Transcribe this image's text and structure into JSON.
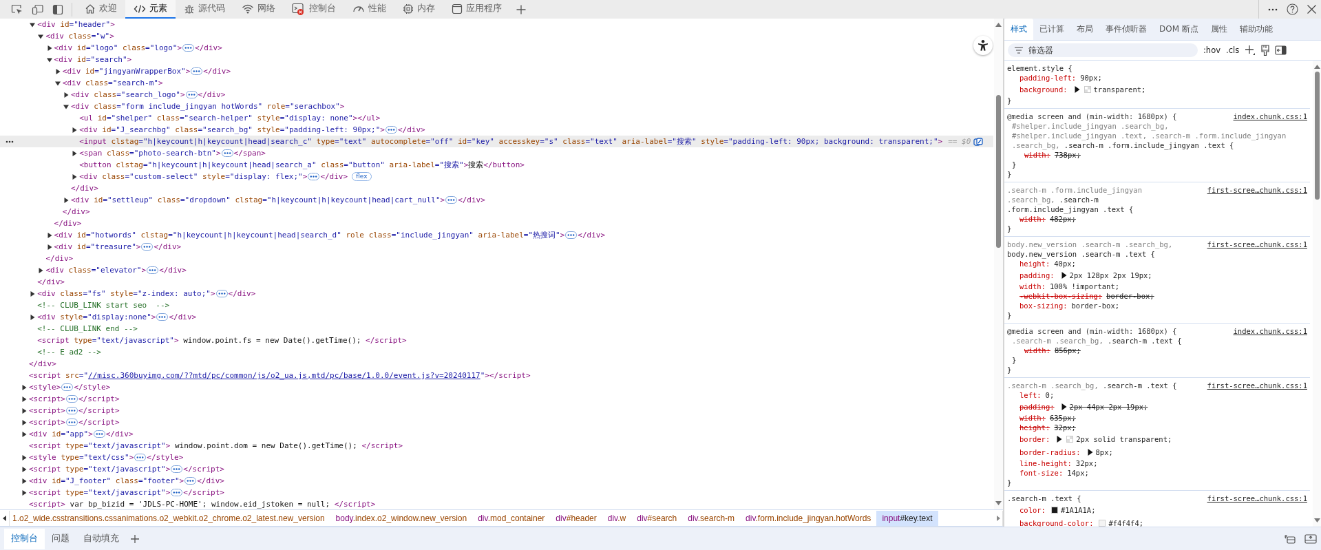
{
  "toolbar": {
    "tabs": [
      {
        "label": "欢迎",
        "selected": false,
        "errors": false
      },
      {
        "label": "元素",
        "selected": true,
        "errors": false
      },
      {
        "label": "源代码",
        "selected": false,
        "errors": false
      },
      {
        "label": "网络",
        "selected": false,
        "errors": false
      },
      {
        "label": "控制台",
        "selected": false,
        "errors": true
      },
      {
        "label": "性能",
        "selected": false,
        "errors": false
      },
      {
        "label": "内存",
        "selected": false,
        "errors": false
      },
      {
        "label": "应用程序",
        "selected": false,
        "errors": false
      }
    ]
  },
  "dom": [
    {
      "children": [
        {
          "open": [
            "<div id=\"header\">"
          ],
          "expanded": true,
          "selected": false,
          "children": [
            {
              "open": [
                "<div class=\"w\">"
              ],
              "expanded": true,
              "selected": false,
              "children": [
                {
                  "open": [
                    "<div id=\"logo\" class=\"logo\">"
                  ],
                  "expanded": false,
                  "selected": false,
                  "close": [
                    "</div>"
                  ]
                },
                {
                  "open": [
                    "<div id=\"search\">"
                  ],
                  "expanded": true,
                  "selected": false,
                  "children": [
                    {
                      "open": [
                        "<div id=\"jingyanWrapperBox\">"
                      ],
                      "expanded": false,
                      "selected": false,
                      "close": [
                        "</div>"
                      ]
                    },
                    {
                      "open": [
                        "<div class=\"search-m\">"
                      ],
                      "expanded": true,
                      "selected": false,
                      "children": [
                        {
                          "open": [
                            "<div class=\"search_logo\">"
                          ],
                          "expanded": false,
                          "selected": false,
                          "close": [
                            "</div>"
                          ]
                        },
                        {
                          "open": [
                            "<div class=\"form include_jingyan hotWords\" role=\"serachbox\">"
                          ],
                          "expanded": true,
                          "selected": false,
                          "children": [
                            {
                              "open": [
                                "<ul id=\"shelper\" class=\"search-helper\" style=\"display: none\">"
                              ],
                              "selected": false,
                              "close": [
                                "</ul>"
                              ]
                            },
                            {
                              "open": [
                                "<div id=\"J_searchbg\" class=\"search_bg\" style=\"padding-left: 90px;\">"
                              ],
                              "expanded": false,
                              "selected": false,
                              "close": [
                                "</div>"
                              ]
                            },
                            {
                              "open": [
                                "<input clstag=\"h|keycount|h|keycount|head|search_c\" type=\"text\" autocomplete=\"off\" id=\"key\" accesskey=\"s\" class=\"text\" aria-label=\"搜索\" style=\"padding-left: 90px; background: transparent;\">"
                              ],
                              "selected": true,
                              "marker": "== $0"
                            },
                            {
                              "open": [
                                "<span class=\"photo-search-btn\">"
                              ],
                              "expanded": false,
                              "selected": false,
                              "close": [
                                "</span>"
                              ]
                            },
                            {
                              "open": [
                                "<button clstag=\"h|keycount|h|keycount|head|search_a\" class=\"button\" aria-label=\"搜索\">",
                                {
                                  "kind": "text",
                                  "text": "搜索"
                                }
                              ],
                              "selected": false,
                              "close": [
                                "</button>"
                              ]
                            },
                            {
                              "open": [
                                "<div class=\"custom-select\" style=\"display: flex;\">"
                              ],
                              "expanded": false,
                              "selected": false,
                              "close": [
                                "</div>"
                              ],
                              "badge": "flex"
                            }
                          ],
                          "close": [
                            "</div>"
                          ]
                        },
                        {
                          "open": [
                            "<div id=\"settleup\" class=\"dropdown\" clstag=\"h|keycount|h|keycount|head|cart_null\">"
                          ],
                          "expanded": false,
                          "selected": false,
                          "close": [
                            "</div>"
                          ]
                        }
                      ],
                      "close": [
                        "</div>"
                      ]
                    }
                  ],
                  "close": [
                    "</div>"
                  ]
                },
                {
                  "open": [
                    "<div id=\"hotwords\" clstag=\"h|keycount|h|keycount|head|search_d\" role class=\"include_jingyan\" aria-label=\"热搜词\">"
                  ],
                  "expanded": false,
                  "selected": false,
                  "close": [
                    "</div>"
                  ]
                },
                {
                  "open": [
                    "<div id=\"treasure\">"
                  ],
                  "expanded": false,
                  "selected": false,
                  "close": [
                    "</div>"
                  ]
                }
              ],
              "close": [
                "</div>"
              ]
            },
            {
              "open": [
                "<div class=\"elevator\">"
              ],
              "expanded": false,
              "selected": false,
              "close": [
                "</div>"
              ]
            }
          ],
          "close": [
            "</div>"
          ]
        },
        {
          "open": [
            "<div class=\"fs\" style=\"z-index: auto;\">"
          ],
          "expanded": false,
          "selected": false,
          "close": [
            "</div>"
          ]
        },
        {
          "open": [
            {
              "kind": "comment",
              "text": "<!-- CLUB_LINK start seo  -->"
            }
          ],
          "selected": false
        },
        {
          "open": [
            "<div style=\"display:none\">"
          ],
          "expanded": false,
          "selected": false,
          "close": [
            "</div>"
          ]
        },
        {
          "open": [
            {
              "kind": "comment",
              "text": "<!-- CLUB_LINK end -->"
            }
          ],
          "selected": false
        },
        {
          "open": [
            "<script type=\"text/javascript\">",
            {
              "kind": "text",
              "text": " window.point.fs = new Date().getTime(); "
            }
          ],
          "selected": false,
          "close": [
            "</script>"
          ]
        },
        {
          "open": [
            {
              "kind": "comment",
              "text": "<!-- E ad2 -->"
            }
          ],
          "selected": false
        }
      ],
      "close": [
        "</div>"
      ]
    },
    {
      "open": [
        "<script src=\"",
        {
          "kind": "link",
          "text": "//misc.360buyimg.com/??mtd/pc/common/js/o2_ua.js,mtd/pc/base/1.0.0/event.js?v=20240117"
        },
        "\">"
      ],
      "selected": false,
      "close": [
        "</script>"
      ]
    },
    {
      "open": [
        "<style>"
      ],
      "expanded": false,
      "selected": false,
      "close": [
        "</style>"
      ]
    },
    {
      "open": [
        "<script>"
      ],
      "expanded": false,
      "selected": false,
      "close": [
        "</script>"
      ]
    },
    {
      "open": [
        "<script>"
      ],
      "expanded": false,
      "selected": false,
      "close": [
        "</script>"
      ]
    },
    {
      "open": [
        "<script>"
      ],
      "expanded": false,
      "selected": false,
      "close": [
        "</script>"
      ]
    },
    {
      "open": [
        "<div id=\"app\">"
      ],
      "expanded": false,
      "selected": false,
      "close": [
        "</div>"
      ]
    },
    {
      "open": [
        "<script type=\"text/javascript\">",
        {
          "kind": "text",
          "text": " window.point.dom = new Date().getTime(); "
        }
      ],
      "selected": false,
      "close": [
        "</script>"
      ]
    },
    {
      "open": [
        "<style type=\"text/css\">"
      ],
      "expanded": false,
      "selected": false,
      "close": [
        "</style>"
      ]
    },
    {
      "open": [
        "<script type=\"text/javascript\">"
      ],
      "expanded": false,
      "selected": false,
      "close": [
        "</script>"
      ]
    },
    {
      "open": [
        "<div id=\"J_footer\" class=\"footer\">"
      ],
      "expanded": false,
      "selected": false,
      "close": [
        "</div>"
      ]
    },
    {
      "open": [
        "<script type=\"text/javascript\">"
      ],
      "expanded": false,
      "selected": false,
      "close": [
        "</script>"
      ]
    },
    {
      "open": [
        "<script>",
        {
          "kind": "text",
          "text": " var bp_bizid = 'JDLS-PC-HOME'; window.eid_jstoken = null; "
        }
      ],
      "selected": false,
      "close": [
        "</script>"
      ]
    }
  ],
  "breadcrumbs": [
    {
      "label": "1.o2_wide.csstransitions.cssanimations.o2_webkit.o2_chrome.o2_latest.new_version",
      "selected": false
    },
    {
      "label": "body.index.o2_window.new_version",
      "selected": false
    },
    {
      "label": "div.mod_container",
      "selected": false
    },
    {
      "label": "div#header",
      "selected": false
    },
    {
      "label": "div.w",
      "selected": false
    },
    {
      "label": "div#search",
      "selected": false
    },
    {
      "label": "div.search-m",
      "selected": false
    },
    {
      "label": "div.form.include_jingyan.hotWords",
      "selected": false
    },
    {
      "label": "input#key.text",
      "selected": true
    }
  ],
  "sidebar": {
    "tabs": [
      {
        "label": "样式",
        "selected": true
      },
      {
        "label": "已计算",
        "selected": false
      },
      {
        "label": "布局",
        "selected": false
      },
      {
        "label": "事件侦听器",
        "selected": false
      },
      {
        "label": "DOM 断点",
        "selected": false
      },
      {
        "label": "属性",
        "selected": false
      },
      {
        "label": "辅助功能",
        "selected": false
      }
    ],
    "filter": {
      "placeholder": "筛选器"
    },
    "toggles": [
      ":hov",
      ".cls"
    ],
    "rules": [
      {
        "selector": [
          [
            {
              "text": "element.style {",
              "matched": true
            }
          ]
        ],
        "close": "}",
        "properties": [
          {
            "name": "padding-left:",
            "value": "90px;",
            "overridden": false,
            "expandable": false,
            "swatch": false
          },
          {
            "name": "background:",
            "value": "transparent;",
            "overridden": false,
            "expandable": true,
            "swatch": true
          }
        ]
      },
      {
        "media": "@media screen and (min-width: 1680px) {",
        "media_close": "}",
        "source": "index.chunk.css:1",
        "selector": [
          [
            {
              "text": "#shelper.include_jingyan .search_bg,",
              "matched": false
            }
          ],
          [
            {
              "text": "#shelper.include_jingyan .text, .search-m .form.include_jingyan",
              "matched": false
            }
          ],
          [
            {
              "text": ".search_bg,",
              "matched": false
            },
            {
              "text": " .search-m .form.include_jingyan .text {",
              "matched": true
            }
          ]
        ],
        "close": "}",
        "properties": [
          {
            "name": "width:",
            "value": "738px;",
            "overridden": true,
            "expandable": false,
            "swatch": false
          }
        ]
      },
      {
        "source": "first-scree…chunk.css:1",
        "selector": [
          [
            {
              "text": ".search-m .form.include_jingyan",
              "matched": false
            }
          ],
          [
            {
              "text": ".search_bg,",
              "matched": false
            },
            {
              "text": " .search-m",
              "matched": true
            }
          ],
          [
            {
              "text": ".form.include_jingyan .text {",
              "matched": true
            }
          ]
        ],
        "close": "}",
        "properties": [
          {
            "name": "width:",
            "value": "482px;",
            "overridden": true,
            "expandable": false,
            "swatch": false
          }
        ]
      },
      {
        "source": "first-scree…chunk.css:1",
        "selector": [
          [
            {
              "text": "body.new_version .search-m .search_bg,",
              "matched": false
            }
          ],
          [
            {
              "text": "body.new_version .search-m .text {",
              "matched": true
            }
          ]
        ],
        "close": "}",
        "properties": [
          {
            "name": "height:",
            "value": "40px;",
            "overridden": false,
            "expandable": false,
            "swatch": false
          },
          {
            "name": "padding:",
            "value": "2px 128px 2px 19px;",
            "overridden": false,
            "expandable": true,
            "swatch": false
          },
          {
            "name": "width:",
            "value": "100% !important;",
            "overridden": false,
            "expandable": false,
            "swatch": false
          },
          {
            "name": "-webkit-box-sizing:",
            "value": "border-box;",
            "overridden": true,
            "expandable": false,
            "swatch": false
          },
          {
            "name": "box-sizing:",
            "value": "border-box;",
            "overridden": false,
            "expandable": false,
            "swatch": false
          }
        ]
      },
      {
        "media": "@media screen and (min-width: 1680px) {",
        "media_close": "}",
        "source": "index.chunk.css:1",
        "selector": [
          [
            {
              "text": ".search-m .search_bg,",
              "matched": false
            },
            {
              "text": " .search-m .text {",
              "matched": true
            }
          ]
        ],
        "close": "}",
        "properties": [
          {
            "name": "width:",
            "value": "856px;",
            "overridden": true,
            "expandable": false,
            "swatch": false
          }
        ]
      },
      {
        "source": "first-scree…chunk.css:1",
        "selector": [
          [
            {
              "text": ".search-m .search_bg,",
              "matched": false
            },
            {
              "text": " .search-m .text {",
              "matched": true
            }
          ]
        ],
        "close": "}",
        "properties": [
          {
            "name": "left:",
            "value": "0;",
            "overridden": false,
            "expandable": false,
            "swatch": false
          },
          {
            "name": "padding:",
            "value": "2px 44px 2px 19px;",
            "overridden": true,
            "expandable": true,
            "swatch": false
          },
          {
            "name": "width:",
            "value": "635px;",
            "overridden": true,
            "expandable": false,
            "swatch": false
          },
          {
            "name": "height:",
            "value": "32px;",
            "overridden": true,
            "expandable": false,
            "swatch": false
          },
          {
            "name": "border:",
            "value": "2px solid transparent;",
            "overridden": false,
            "expandable": true,
            "swatch": true
          },
          {
            "name": "border-radius:",
            "value": "8px;",
            "overridden": false,
            "expandable": true,
            "swatch": false
          },
          {
            "name": "line-height:",
            "value": "32px;",
            "overridden": false,
            "expandable": false,
            "swatch": false
          },
          {
            "name": "font-size:",
            "value": "14px;",
            "overridden": false,
            "expandable": false,
            "swatch": false
          }
        ]
      },
      {
        "source": "first-scree…chunk.css:1",
        "selector": [
          [
            {
              "text": ".search-m .text {",
              "matched": true
            }
          ]
        ],
        "properties": [
          {
            "name": "color:",
            "value": "#1A1A1A;",
            "overridden": false,
            "expandable": false,
            "swatch": true,
            "color": "#1a1a1a"
          },
          {
            "name": "background-color:",
            "value": "#f4f4f4;",
            "overridden": false,
            "expandable": false,
            "swatch": true,
            "color": "#f4f4f4"
          }
        ]
      }
    ]
  },
  "drawer": {
    "tabs": [
      {
        "label": "控制台",
        "selected": true
      },
      {
        "label": "问题",
        "selected": false
      },
      {
        "label": "自动填充",
        "selected": false
      }
    ]
  }
}
